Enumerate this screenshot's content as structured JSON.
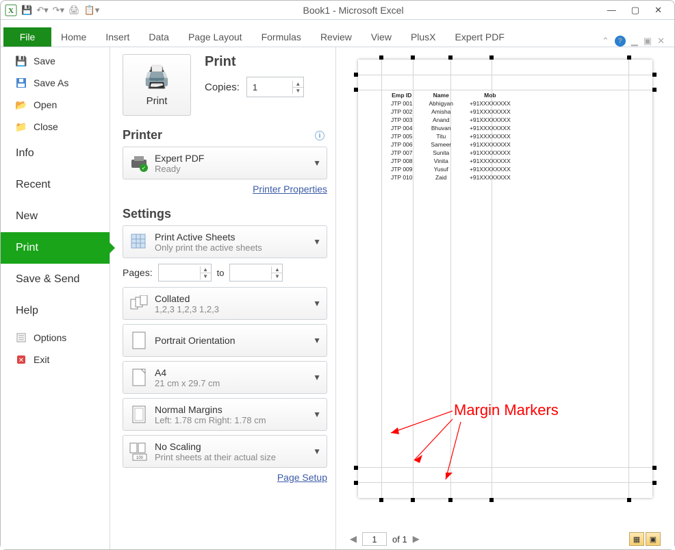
{
  "window": {
    "title": "Book1 - Microsoft Excel"
  },
  "tabs": {
    "file": "File",
    "home": "Home",
    "insert": "Insert",
    "data": "Data",
    "page_layout": "Page Layout",
    "formulas": "Formulas",
    "review": "Review",
    "view": "View",
    "plusx": "PlusX",
    "expert_pdf": "Expert PDF"
  },
  "sidebar": {
    "save": "Save",
    "save_as": "Save As",
    "open": "Open",
    "close": "Close",
    "info": "Info",
    "recent": "Recent",
    "new": "New",
    "print": "Print",
    "save_send": "Save & Send",
    "help": "Help",
    "options": "Options",
    "exit": "Exit"
  },
  "print_panel": {
    "print_heading": "Print",
    "print_btn": "Print",
    "copies_label": "Copies:",
    "copies_value": "1",
    "printer_heading": "Printer",
    "printer_name": "Expert PDF",
    "printer_status": "Ready",
    "printer_props": "Printer Properties",
    "settings_heading": "Settings",
    "print_active": "Print Active Sheets",
    "print_active_sub": "Only print the active sheets",
    "pages_label": "Pages:",
    "pages_to": "to",
    "collated": "Collated",
    "collated_sub": "1,2,3    1,2,3    1,2,3",
    "orientation": "Portrait Orientation",
    "paper": "A4",
    "paper_sub": "21 cm x 29.7 cm",
    "margins": "Normal Margins",
    "margins_sub": "Left:  1.78 cm    Right:  1.78 cm",
    "scaling": "No Scaling",
    "scaling_sub": "Print sheets at their actual size",
    "page_setup": "Page Setup"
  },
  "preview": {
    "page_num": "1",
    "page_total": "of  1",
    "annotation": "Margin Markers",
    "table": {
      "headers": [
        "Emp ID",
        "Name",
        "Mob"
      ],
      "rows": [
        [
          "JTP 001",
          "Abhigyan",
          "+91XXXXXXXX"
        ],
        [
          "JTP 002",
          "Amisha",
          "+91XXXXXXXX"
        ],
        [
          "JTP 003",
          "Anand",
          "+91XXXXXXXX"
        ],
        [
          "JTP 004",
          "Bhuvan",
          "+91XXXXXXXX"
        ],
        [
          "JTP 005",
          "Titu",
          "+91XXXXXXXX"
        ],
        [
          "JTP 006",
          "Sameer",
          "+91XXXXXXXX"
        ],
        [
          "JTP 007",
          "Sunita",
          "+91XXXXXXXX"
        ],
        [
          "JTP 008",
          "Vinita",
          "+91XXXXXXXX"
        ],
        [
          "JTP 009",
          "Yusuf",
          "+91XXXXXXXX"
        ],
        [
          "JTP 010",
          "Zaid",
          "+91XXXXXXXX"
        ]
      ]
    }
  }
}
